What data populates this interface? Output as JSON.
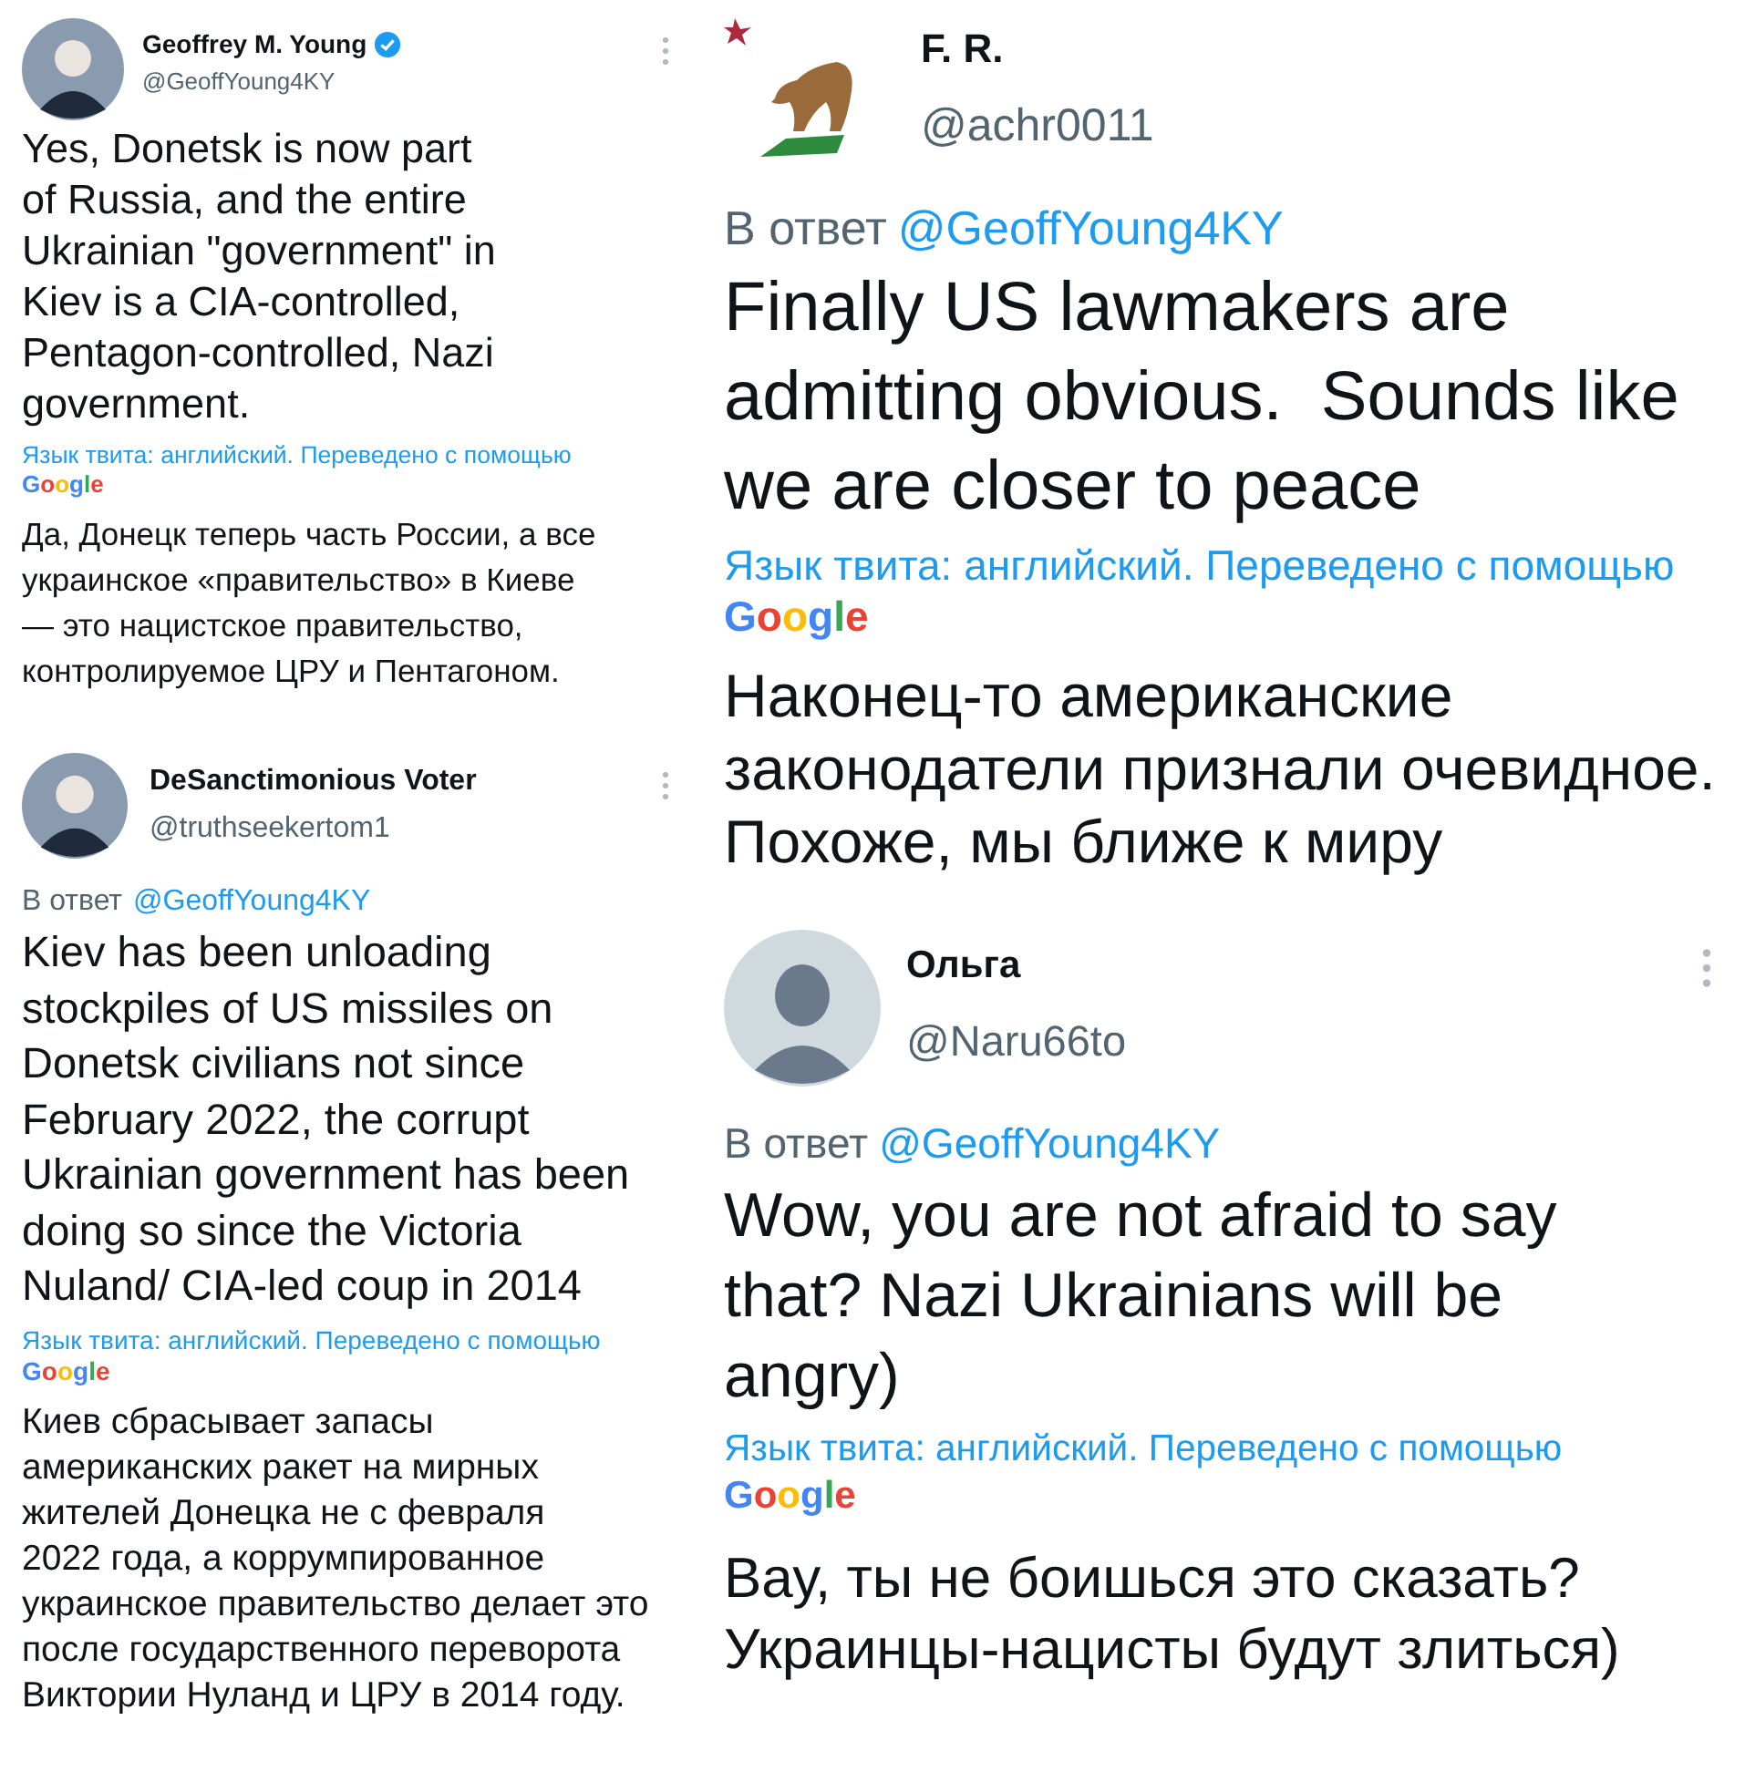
{
  "columns": [
    {
      "tweets": [
        {
          "kind": "person",
          "author": "Geoffrey M. Young",
          "verified": true,
          "handle": "@GeoffYoung4KY",
          "menu": true,
          "text_lines": [
            "Yes, Donetsk is now part",
            "of Russia, and the entire",
            "Ukrainian \"government\" in",
            "Kiev is a CIA-controlled,",
            "Pentagon-controlled, Nazi",
            "government."
          ],
          "translation_note": "Язык твита: английский. Переведено с помощью",
          "translation_logo": "Google",
          "translation_lines": [
            "Да, Донецк теперь часть России, а все",
            "украинское «правительство» в Киеве",
            "— это нацистское правительство,",
            "контролируемое ЦРУ и Пентагоном."
          ]
        },
        {
          "kind": "person",
          "author": "DeSanctimonious Voter",
          "verified": false,
          "handle": "@truthseekertom1",
          "menu": true,
          "reply_prefix": "В ответ",
          "reply_handle": "@GeoffYoung4KY",
          "text_lines": [
            "Kiev has been unloading",
            "stockpiles of US missiles on",
            "Donetsk civilians not since",
            "February 2022, the corrupt",
            "Ukrainian government has been",
            "doing so since the Victoria",
            "Nuland/ CIA-led coup in 2014"
          ],
          "translation_note": "Язык твита: английский. Переведено с помощью",
          "translation_logo": "Google",
          "translation_lines": [
            "Киев сбрасывает запасы",
            "американских ракет на мирных",
            "жителей Донецка не с февраля",
            "2022 года, а коррумпированное",
            "украинское правительство делает это",
            "после государственного переворота",
            "Виктории Нуланд и ЦРУ в 2014 году."
          ]
        }
      ]
    },
    {
      "tweets": [
        {
          "kind": "bear",
          "author": "F. R.",
          "verified": false,
          "handle": "@achr0011",
          "menu": false,
          "reply_prefix": "В ответ",
          "reply_handle": "@GeoffYoung4KY",
          "text_lines": [
            "Finally US lawmakers are",
            "admitting obvious.  Sounds like",
            "we are closer to peace"
          ],
          "translation_note": "Язык твита: английский. Переведено с помощью",
          "translation_logo": "Google",
          "translation_lines": [
            "Наконец-то американские",
            "законодатели признали очевидное.",
            "Похоже, мы ближе к миру"
          ]
        },
        {
          "kind": "default",
          "author": "Ольга",
          "verified": false,
          "handle": "@Naru66to",
          "menu": true,
          "reply_prefix": "В ответ",
          "reply_handle": "@GeoffYoung4KY",
          "text_lines": [
            "Wow, you are not afraid to say",
            "that? Nazi Ukrainians will be",
            "angry)"
          ],
          "translation_note": "Язык твита: английский. Переведено с помощью",
          "translation_logo": "Google",
          "translation_lines": [
            "Вау, ты не боишься это сказать?",
            "Украинцы-нацисты будут злиться)"
          ]
        }
      ]
    }
  ]
}
